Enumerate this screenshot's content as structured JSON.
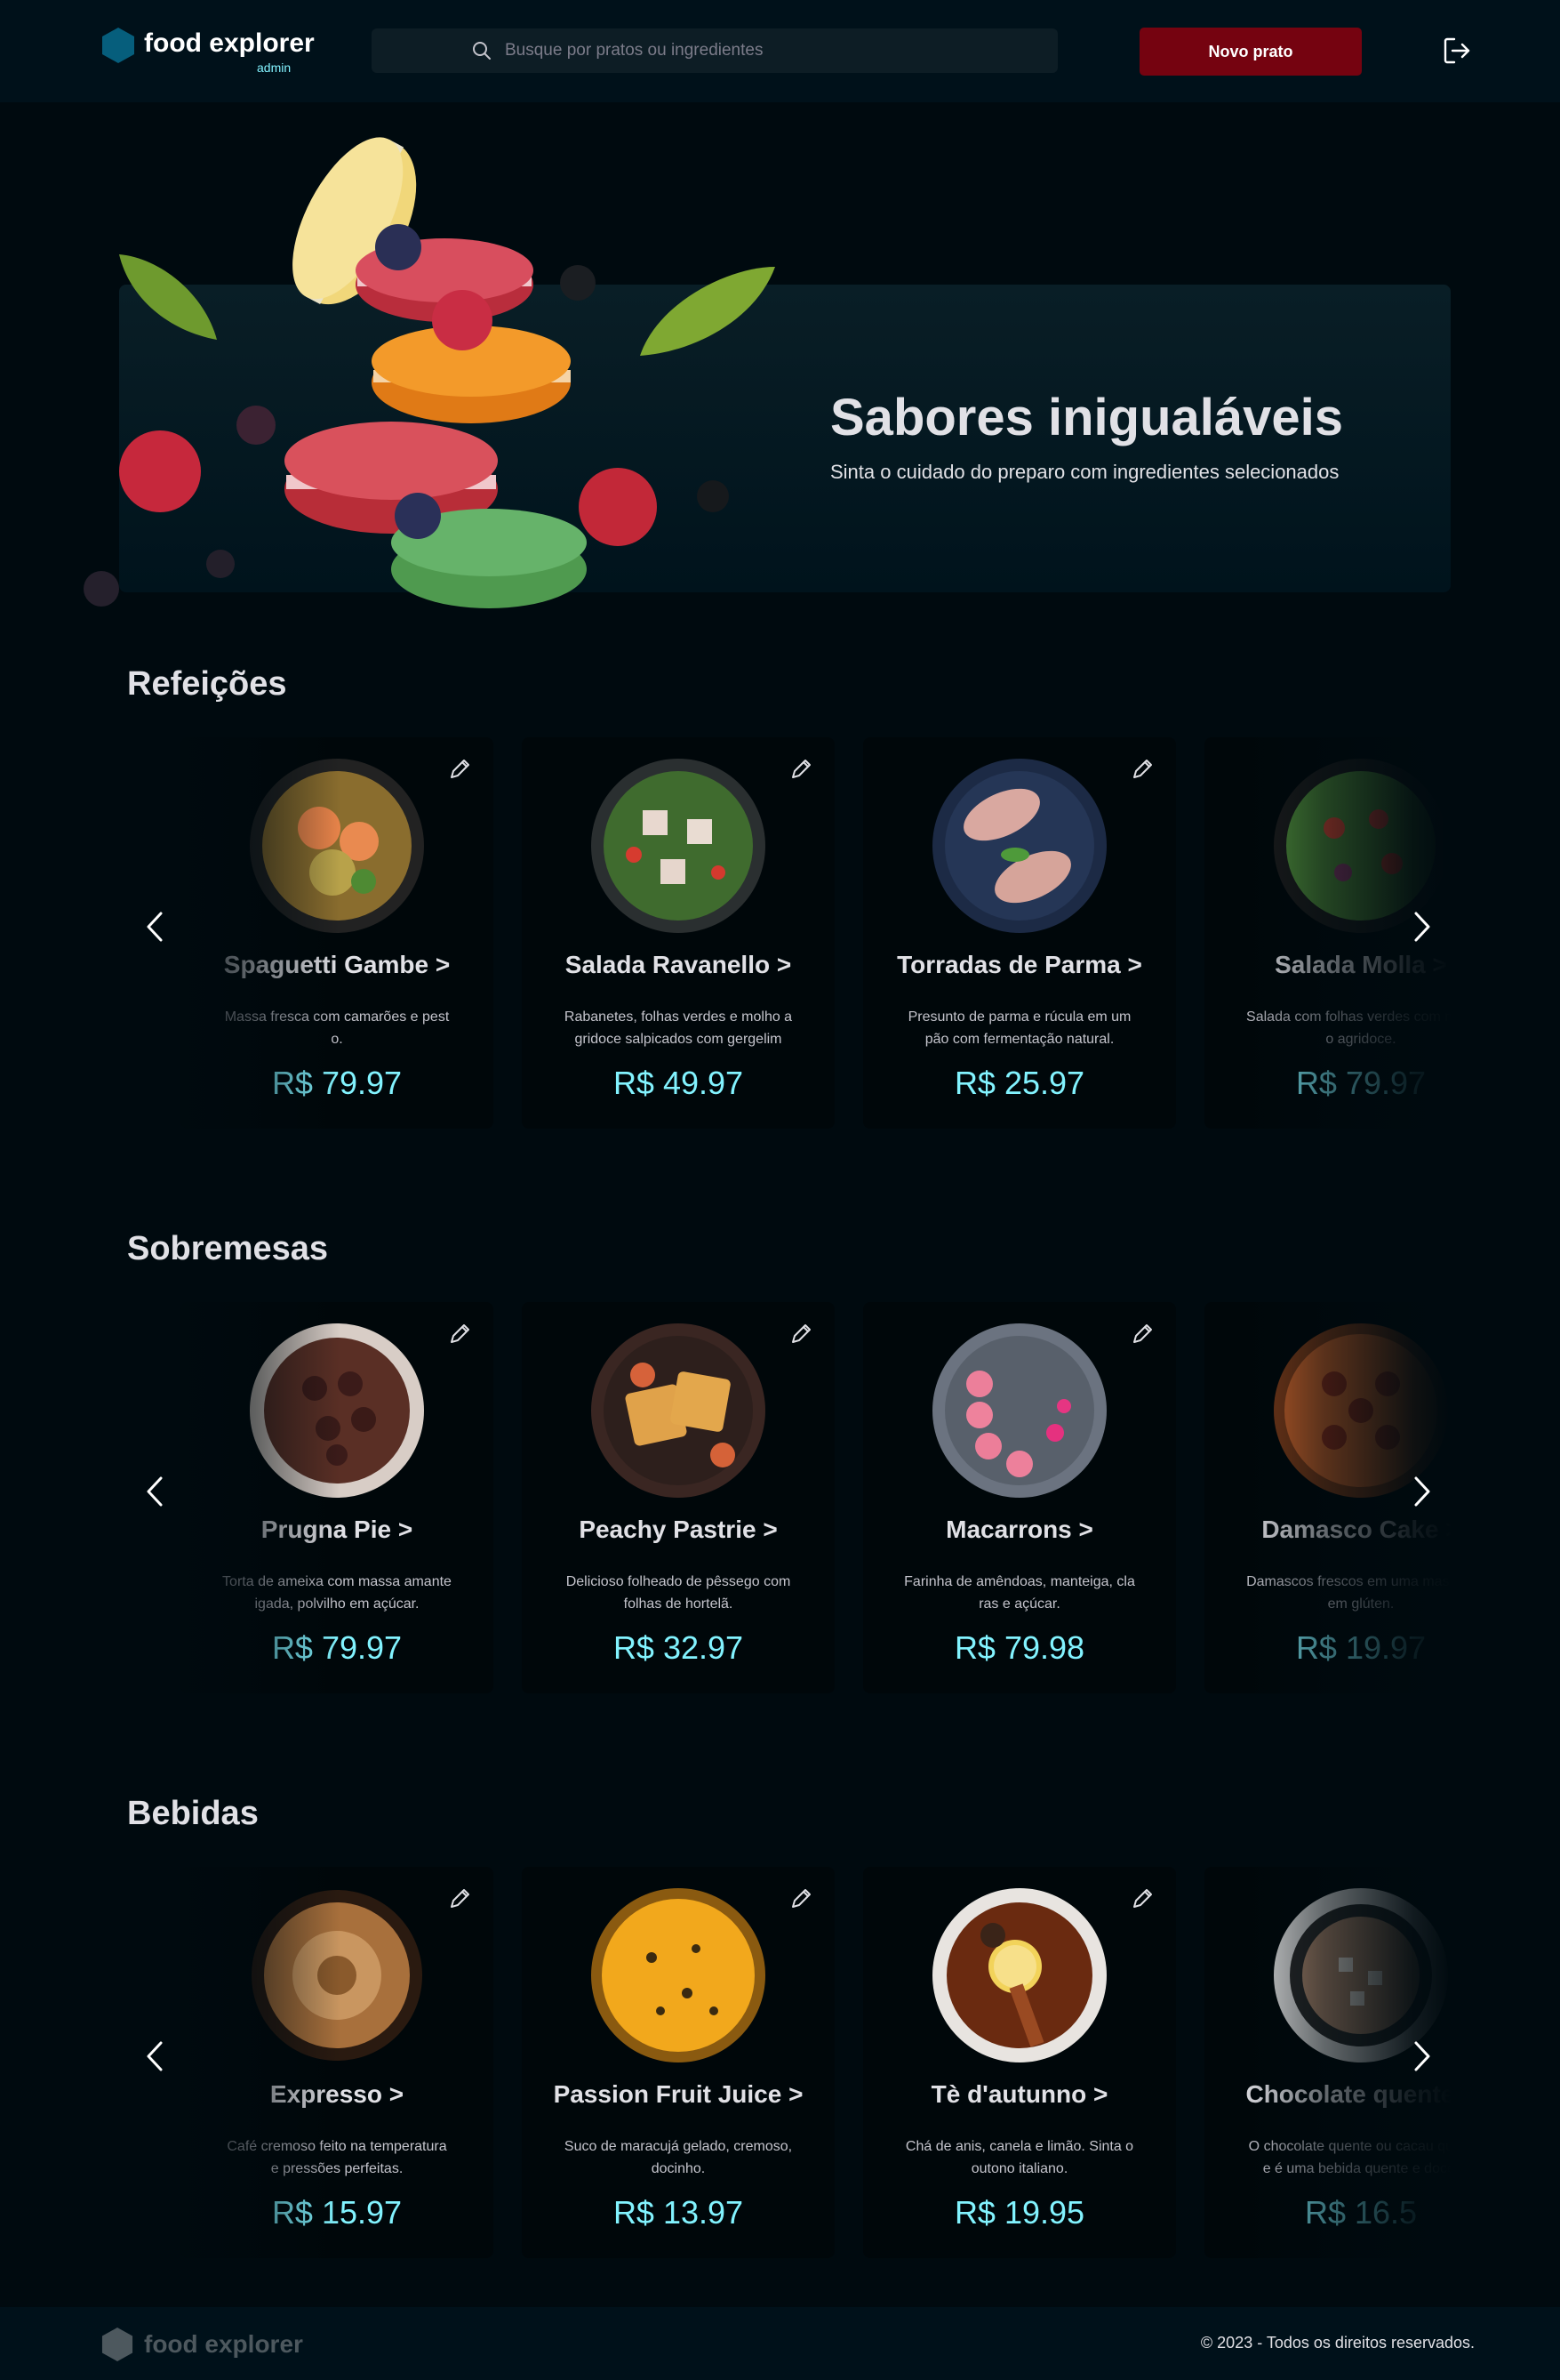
{
  "header": {
    "brand": "food explorer",
    "role_badge": "admin",
    "search_placeholder": "Busque por pratos ou ingredientes",
    "new_dish_label": "Novo prato"
  },
  "banner": {
    "title": "Sabores inigualáveis",
    "subtitle": "Sinta o cuidado do preparo com ingredientes selecionados"
  },
  "sections": [
    {
      "title": "Refeições",
      "dishes": [
        {
          "name": "Spaguetti Gambe >",
          "description": "Massa fresca com camarões e pesto.",
          "price": "R$ 79.97"
        },
        {
          "name": "Salada Ravanello >",
          "description": "Rabanetes, folhas verdes e molho agridoce salpicados com gergelim",
          "price": "R$ 49.97"
        },
        {
          "name": "Torradas de Parma >",
          "description": "Presunto de parma e rúcula em um pão com fermentação natural.",
          "price": "R$ 25.97"
        },
        {
          "name": "Salada Molla >",
          "description": "Salada com folhas verdes com molho agridoce.",
          "price": "R$ 79.97"
        }
      ]
    },
    {
      "title": "Sobremesas",
      "dishes": [
        {
          "name": "Prugna Pie >",
          "description": "Torta de ameixa com massa amanteigada, polvilho em açúcar.",
          "price": "R$ 79.97"
        },
        {
          "name": "Peachy Pastrie >",
          "description": "Delicioso folheado de pêssego com folhas de hortelã.",
          "price": "R$ 32.97"
        },
        {
          "name": "Macarrons >",
          "description": "Farinha de amêndoas, manteiga, claras e açúcar.",
          "price": "R$ 79.98"
        },
        {
          "name": "Damasco Cake >",
          "description": "Damascos frescos em uma massa sem glúten.",
          "price": "R$ 19.97"
        }
      ]
    },
    {
      "title": "Bebidas",
      "dishes": [
        {
          "name": "Expresso >",
          "description": "Café cremoso feito na temperatura e pressões perfeitas.",
          "price": "R$ 15.97"
        },
        {
          "name": "Passion Fruit Juice >",
          "description": "Suco de maracujá gelado, cremoso, docinho.",
          "price": "R$ 13.97"
        },
        {
          "name": "Tè d'autunno >",
          "description": "Chá de anis, canela e limão. Sinta o outono italiano.",
          "price": "R$ 19.95"
        },
        {
          "name": "Chocolate quente >",
          "description": "O chocolate quente ou cacau quente é uma bebida quente e doce.",
          "price": "R$ 16.5"
        }
      ]
    }
  ],
  "footer": {
    "brand": "food explorer",
    "copyright": "© 2023 - Todos os direitos reservados."
  },
  "colors": {
    "background": "#000a0f",
    "header": "#00111a",
    "accent_price": "#82f3ff",
    "button": "#750310",
    "logo": "#065e7c"
  }
}
